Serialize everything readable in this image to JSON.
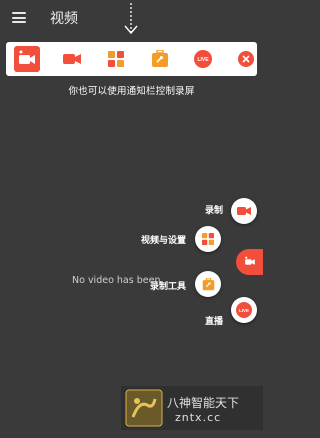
{
  "appbar": {
    "title": "视频"
  },
  "notification_bar": {
    "buttons": [
      {
        "name": "app-logo-record",
        "icon": "screen-record-icon"
      },
      {
        "name": "record",
        "icon": "video-camera-icon"
      },
      {
        "name": "videos",
        "icon": "grid-icon"
      },
      {
        "name": "toolbox",
        "icon": "toolbox-icon"
      },
      {
        "name": "live",
        "icon": "live-icon",
        "badge": "LIVE"
      },
      {
        "name": "exit",
        "icon": "close-icon"
      }
    ]
  },
  "hint": "你也可以使用通知栏控制录屏",
  "empty_state": "No video has been",
  "fab_menu": {
    "items": [
      {
        "label": "录制",
        "icon": "video-camera-icon"
      },
      {
        "label": "视频与设置",
        "icon": "grid-icon"
      },
      {
        "label": "录制工具",
        "icon": "toolbox-icon"
      },
      {
        "label": "直播",
        "icon": "live-icon",
        "badge": "LIVE"
      }
    ]
  },
  "watermark": {
    "line1": "八神智能天下",
    "line2": "zntx.cc"
  },
  "colors": {
    "accent_red": "#f24e3c",
    "accent_orange": "#f39c2a",
    "background": "#3a3a3a"
  }
}
